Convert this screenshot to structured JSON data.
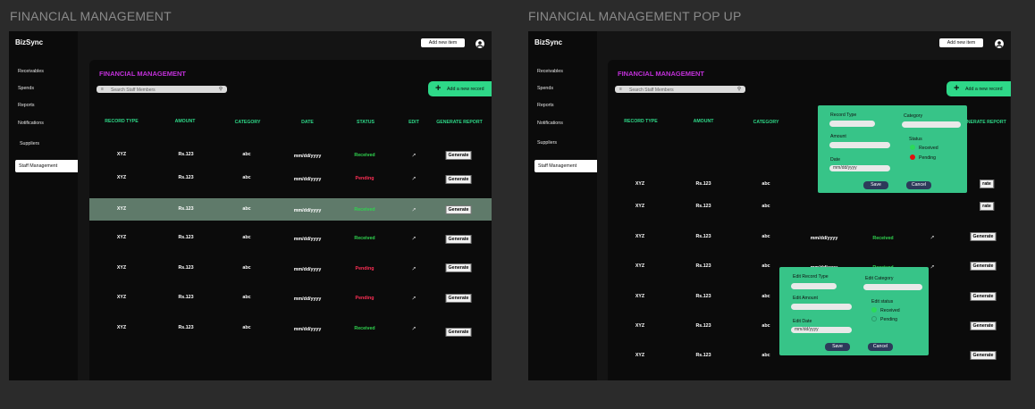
{
  "frames": [
    {
      "title": "FINANCIAL MANAGEMENT"
    },
    {
      "title": "FINANCIAL MANAGEMENT POP UP"
    }
  ],
  "app": {
    "brand": "BizSync",
    "add_item": "Add new item",
    "nav": [
      "Receivables",
      "Spends",
      "Reports",
      "Notifications",
      "Suppliers",
      "Staff Management"
    ],
    "active_nav": "Staff Management"
  },
  "panel": {
    "title": "FINANCIAL MANAGEMENT",
    "search_placeholder": "Search Staff Members",
    "add_record": "Add a new record",
    "columns": [
      "RECORD TYPE",
      "AMOUNT",
      "CATEGORY",
      "DATE",
      "STATUS",
      "EDIT",
      "GENERATE REPORT"
    ],
    "generate_label": "Generate",
    "rows": [
      {
        "type": "XYZ",
        "amount": "Rs.123",
        "category": "abc",
        "date": "mm/dd/yyyy",
        "status": "Received"
      },
      {
        "type": "XYZ",
        "amount": "Rs.123",
        "category": "abc",
        "date": "mm/dd/yyyy",
        "status": "Pending"
      },
      {
        "type": "XYZ",
        "amount": "Rs.123",
        "category": "abc",
        "date": "mm/dd/yyyy",
        "status": "Received"
      },
      {
        "type": "XYZ",
        "amount": "Rs.123",
        "category": "abc",
        "date": "mm/dd/yyyy",
        "status": "Received"
      },
      {
        "type": "XYZ",
        "amount": "Rs.123",
        "category": "abc",
        "date": "mm/dd/yyyy",
        "status": "Pending"
      },
      {
        "type": "XYZ",
        "amount": "Rs.123",
        "category": "abc",
        "date": "mm/dd/yyyy",
        "status": "Pending"
      },
      {
        "type": "XYZ",
        "amount": "Rs.123",
        "category": "abc",
        "date": "mm/dd/yyyy",
        "status": "Received"
      }
    ],
    "highlighted_row": 2,
    "popup_visible_statuses": [
      "Received",
      "Received"
    ],
    "popup_visible_gen": [
      "rate",
      "rate"
    ]
  },
  "popup_add": {
    "record_type": "Record Type",
    "category": "Category",
    "amount": "Amount",
    "status": "Status",
    "received": "Received",
    "pending": "Pending",
    "date": "Date",
    "date_placeholder": "mm/dd/yyyy",
    "save": "Save",
    "cancel": "Cancel"
  },
  "popup_edit": {
    "record_type": "Edit Record Type",
    "category": "Edit Category",
    "amount": "Edit Amount",
    "status": "Edit status",
    "received": "Received",
    "pending": "Pending",
    "date": "Edit Date",
    "date_placeholder": "mm/dd/yyyy",
    "save": "Save",
    "cancel": "Cancel"
  },
  "colors": {
    "accent": "#2ed888",
    "title": "#c030d8",
    "received": "#30d44f",
    "pending": "#ff2f55",
    "popup": "#37c488",
    "popup_button": "#2d3a5a",
    "dot_green": "#2cd95a",
    "dot_red": "#e01010"
  }
}
